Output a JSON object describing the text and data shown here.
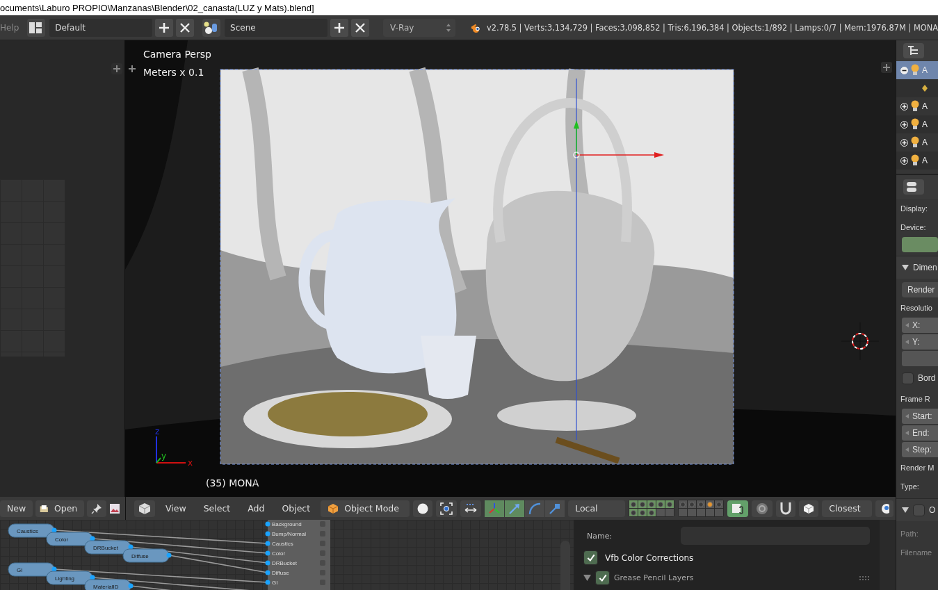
{
  "title_bar": {
    "title": "ocuments\\Laburo PROPIO\\Manzanas\\Blender\\02_canasta(LUZ y Mats).blend]"
  },
  "header": {
    "menu": "Help",
    "layout": "Default",
    "scene": "Scene",
    "render_engine": "V-Ray",
    "stats": "v2.78.5 | Verts:3,134,729 | Faces:3,098,852 | Tris:6,196,384 | Objects:1/892 | Lamps:0/7 | Mem:1976.87M | MONA"
  },
  "viewport": {
    "view_name": "Camera Persp",
    "units": "Meters x 0.1",
    "object_label": "(35) MONA",
    "axis_labels": [
      "x",
      "y",
      "z"
    ]
  },
  "outliner": {
    "rows": [
      {
        "kind": "item",
        "label": "A",
        "expanded": true,
        "selected": true
      },
      {
        "kind": "child",
        "selected": false
      },
      {
        "kind": "item",
        "label": "A",
        "expanded": false,
        "selected": false
      },
      {
        "kind": "item",
        "label": "A",
        "expanded": false,
        "selected": false
      },
      {
        "kind": "item",
        "label": "A",
        "expanded": false,
        "selected": false
      },
      {
        "kind": "item",
        "label": "A",
        "expanded": false,
        "selected": false
      }
    ]
  },
  "render_panel": {
    "items": [
      {
        "kind": "label",
        "text": "Display:",
        "disabled": false
      },
      {
        "kind": "label",
        "text": "Device:",
        "disabled": false
      },
      {
        "kind": "bar"
      },
      {
        "kind": "section",
        "text": "Dimen",
        "expanded": true
      },
      {
        "kind": "dropdown",
        "text": "Render"
      },
      {
        "kind": "label",
        "text": "Resolutio",
        "disabled": false
      },
      {
        "kind": "number",
        "text": "X:"
      },
      {
        "kind": "number",
        "text": "Y:"
      },
      {
        "kind": "blank"
      },
      {
        "kind": "checkbox",
        "text": "Bord",
        "checked": false
      },
      {
        "kind": "label",
        "text": "Frame R",
        "disabled": false
      },
      {
        "kind": "number",
        "text": "Start:"
      },
      {
        "kind": "number",
        "text": "End:"
      },
      {
        "kind": "number",
        "text": "Step:"
      },
      {
        "kind": "label",
        "text": "Render M",
        "disabled": false
      },
      {
        "kind": "label",
        "text": "Type:",
        "disabled": false
      },
      {
        "kind": "section_check",
        "text": "O",
        "expanded": true,
        "checked": false
      },
      {
        "kind": "label",
        "text": "Path:",
        "disabled": true
      },
      {
        "kind": "label",
        "text": "Filename",
        "disabled": true
      }
    ]
  },
  "image_toolbar": {
    "new": "New",
    "open": "Open"
  },
  "view3d_header": {
    "menus": [
      "View",
      "Select",
      "Add",
      "Object"
    ],
    "mode": "Object Mode",
    "manipulators": [
      {
        "kind": "axes",
        "selected": true
      },
      {
        "kind": "translate",
        "selected": true
      },
      {
        "kind": "rotate",
        "selected": false
      },
      {
        "kind": "scale",
        "selected": false
      }
    ],
    "orientation": "Local",
    "layers": [
      {
        "used": true,
        "has_object": false,
        "selected": true
      },
      {
        "used": true,
        "has_object": false,
        "selected": true
      },
      {
        "used": true,
        "has_object": false,
        "selected": true
      },
      {
        "used": true,
        "has_object": false,
        "selected": true
      },
      {
        "used": true,
        "has_object": false,
        "selected": true
      },
      {
        "used": true,
        "has_object": false,
        "selected": true
      },
      {
        "used": true,
        "has_object": false,
        "selected": true
      },
      {
        "used": true,
        "has_object": false,
        "selected": true
      },
      {
        "used": false,
        "has_object": false,
        "selected": false
      },
      {
        "used": false,
        "has_object": false,
        "selected": false
      },
      {
        "used": true,
        "has_object": false,
        "selected": false
      },
      {
        "used": true,
        "has_object": false,
        "selected": false
      },
      {
        "used": true,
        "has_object": false,
        "selected": false
      },
      {
        "used": true,
        "has_object": true,
        "selected": false
      },
      {
        "used": true,
        "has_object": false,
        "selected": false
      },
      {
        "used": false,
        "has_object": false,
        "selected": false
      },
      {
        "used": false,
        "has_object": false,
        "selected": false
      },
      {
        "used": false,
        "has_object": false,
        "selected": false
      },
      {
        "used": false,
        "has_object": false,
        "selected": false
      },
      {
        "used": false,
        "has_object": false,
        "selected": false
      }
    ],
    "lock_layers": true,
    "proportional_editing": false,
    "snap": false,
    "snap_target": "Closest"
  },
  "node_editor": {
    "nodes": [
      {
        "label": "Caustics"
      },
      {
        "label": "Color"
      },
      {
        "label": "DRBucket"
      },
      {
        "label": "Diffuse"
      },
      {
        "label": "GI"
      },
      {
        "label": "Lighting"
      },
      {
        "label": "MaterialID"
      }
    ],
    "sockets": [
      {
        "label": "Background"
      },
      {
        "label": "Bump/Normal"
      },
      {
        "label": "Caustics"
      },
      {
        "label": "Color"
      },
      {
        "label": "DRBucket"
      },
      {
        "label": "Diffuse"
      },
      {
        "label": "GI"
      }
    ]
  },
  "properties": {
    "name_label": "Name:",
    "options": [
      {
        "kind": "checkbox",
        "text": "Vfb Color Corrections",
        "checked": true
      },
      {
        "kind": "section",
        "text": "Grease Pencil Layers",
        "expanded": true,
        "checked": true
      }
    ]
  }
}
